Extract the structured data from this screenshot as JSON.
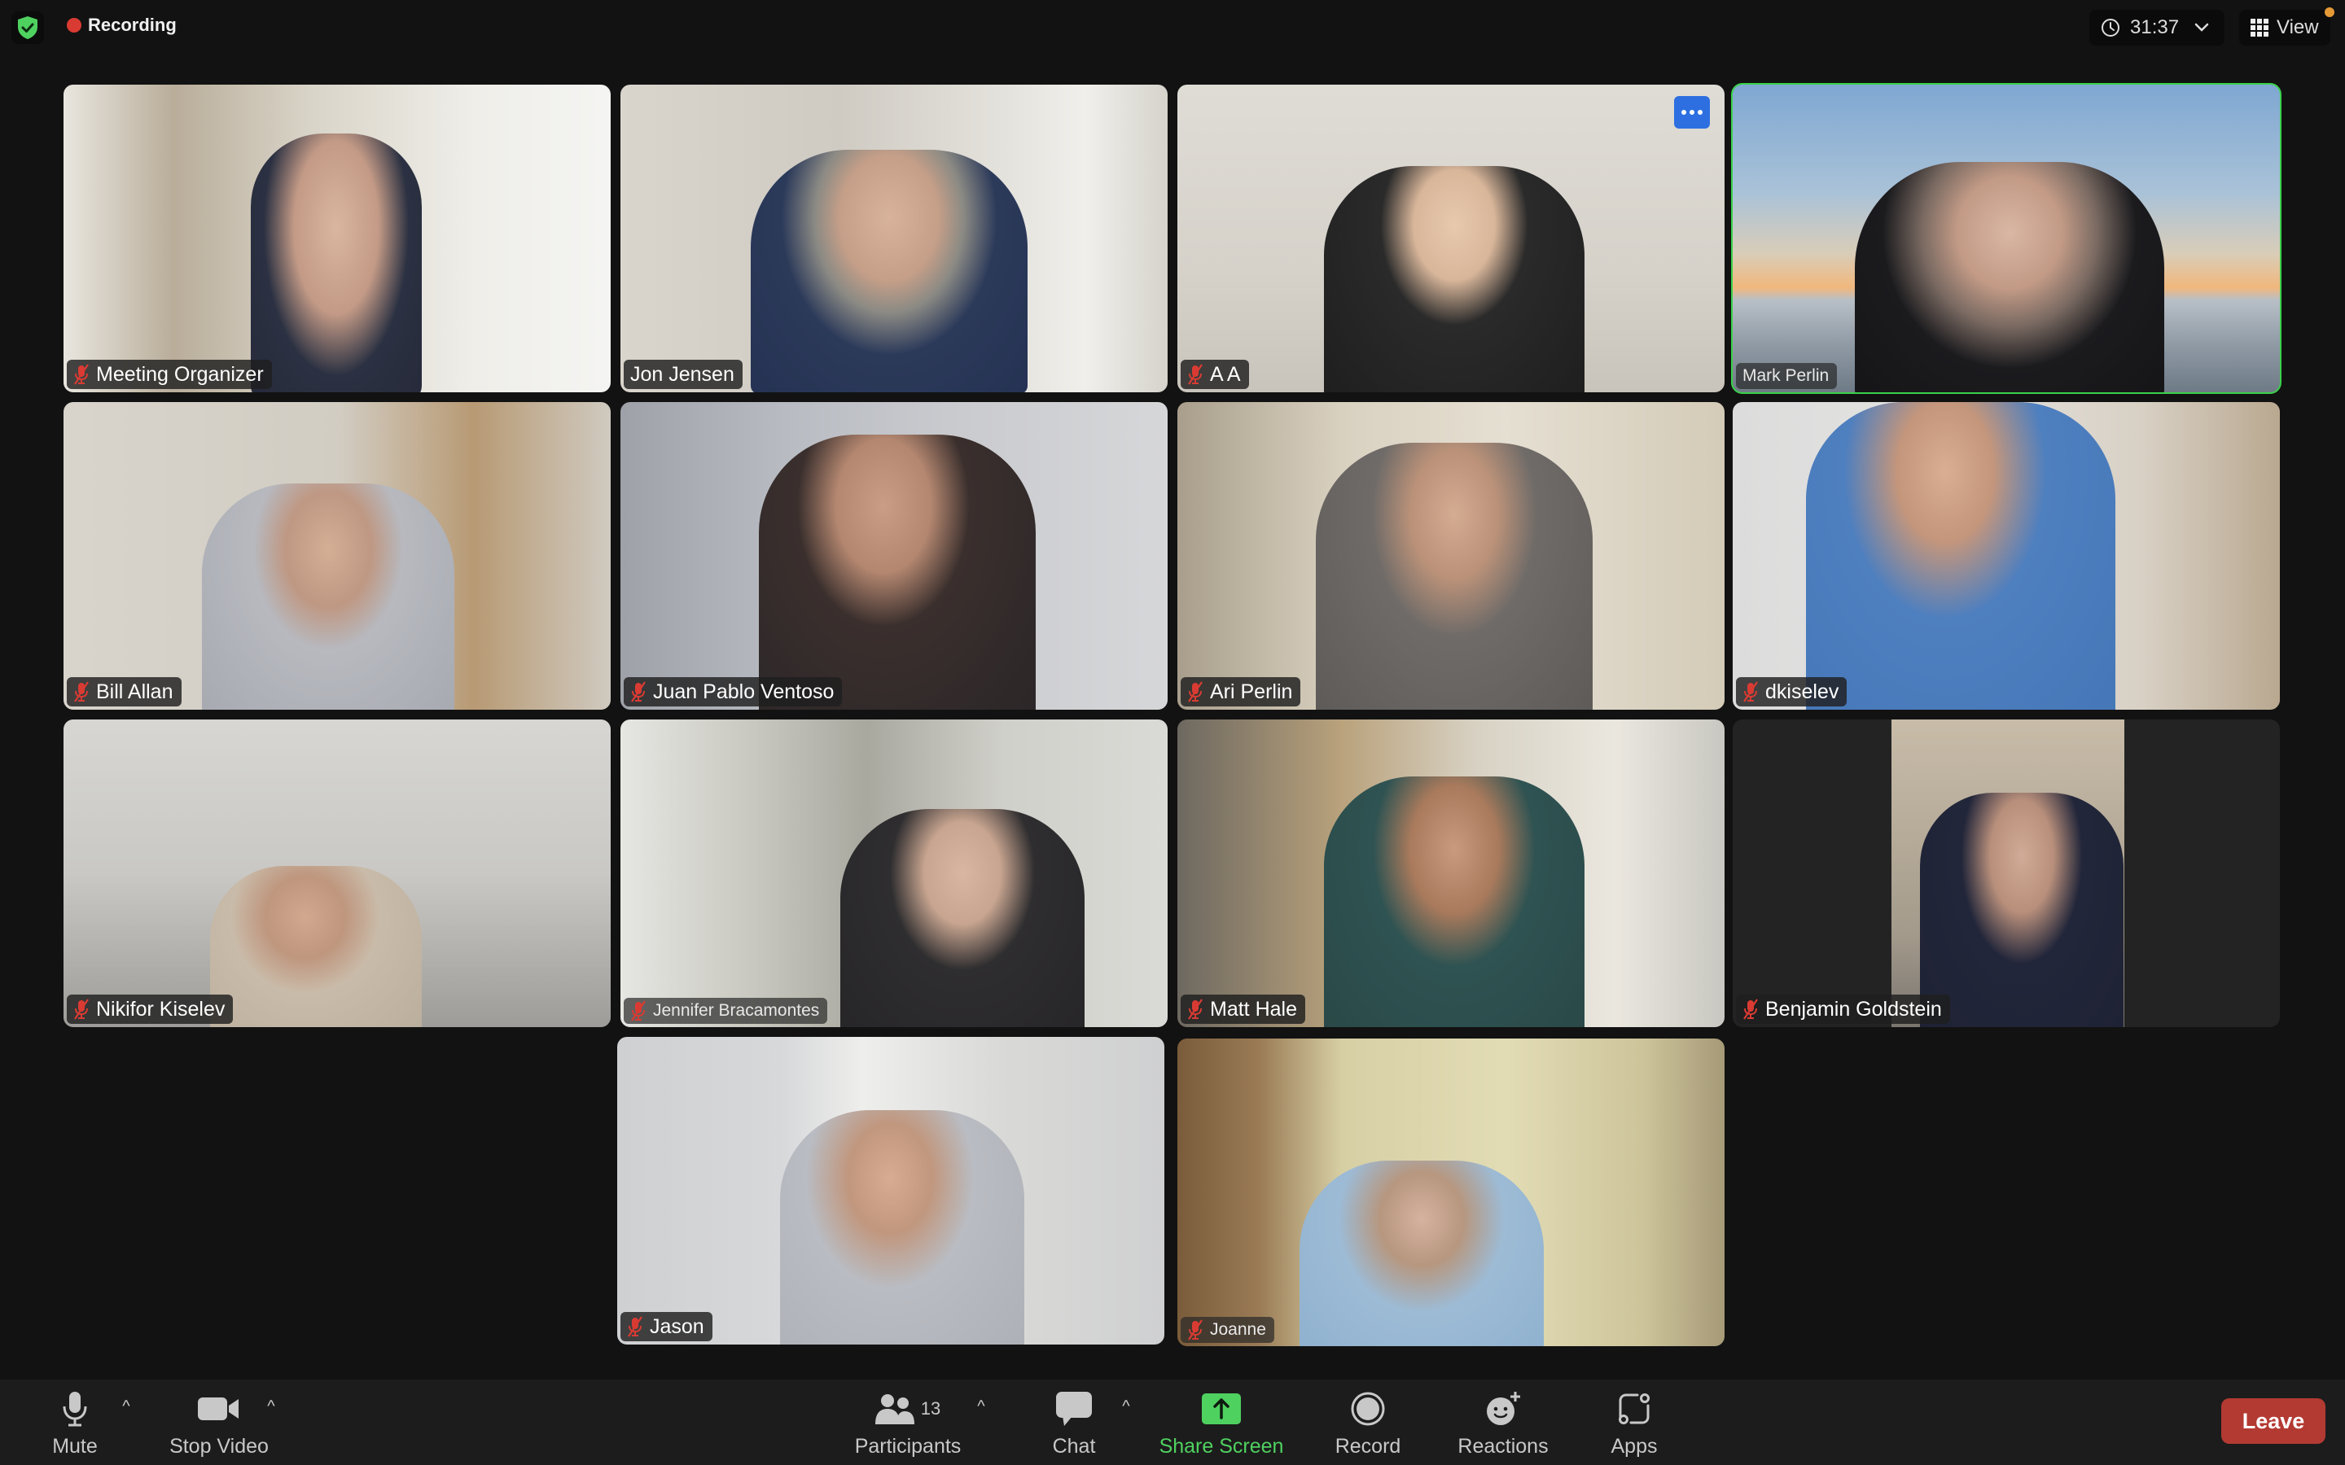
{
  "topbar": {
    "security_icon": "shield-check-icon",
    "recording_label": "Recording",
    "timer": "31:37",
    "view_label": "View",
    "colors": {
      "recording_dot": "#d93b33",
      "security": "#4fd160",
      "notification": "#e59a36"
    }
  },
  "participants": [
    {
      "name": "Meeting Organizer",
      "muted": true,
      "active_speaker": false
    },
    {
      "name": "Jon Jensen",
      "muted": false,
      "active_speaker": false
    },
    {
      "name": "A A",
      "muted": true,
      "active_speaker": false,
      "has_more_menu": true
    },
    {
      "name": "Mark Perlin",
      "muted": false,
      "active_speaker": true
    },
    {
      "name": "Bill Allan",
      "muted": true,
      "active_speaker": false
    },
    {
      "name": "Juan Pablo Ventoso",
      "muted": true,
      "active_speaker": false
    },
    {
      "name": "Ari Perlin",
      "muted": true,
      "active_speaker": false
    },
    {
      "name": "dkiselev",
      "muted": true,
      "active_speaker": false
    },
    {
      "name": "Nikifor Kiselev",
      "muted": true,
      "active_speaker": false
    },
    {
      "name": "Jennifer Bracamontes",
      "muted": true,
      "active_speaker": false
    },
    {
      "name": "Matt Hale",
      "muted": true,
      "active_speaker": false
    },
    {
      "name": "Benjamin Goldstein",
      "muted": true,
      "active_speaker": false
    },
    {
      "name": "Jason",
      "muted": true,
      "active_speaker": false
    },
    {
      "name": "Joanne",
      "muted": true,
      "active_speaker": false
    }
  ],
  "toolbar": {
    "mute_label": "Mute",
    "stop_video_label": "Stop Video",
    "participants_label": "Participants",
    "participants_count": "13",
    "chat_label": "Chat",
    "share_screen_label": "Share Screen",
    "record_label": "Record",
    "reactions_label": "Reactions",
    "apps_label": "Apps",
    "leave_label": "Leave",
    "colors": {
      "share": "#4fd160",
      "leave": "#b33a32",
      "active_speaker_border": "#3ad14a"
    }
  }
}
